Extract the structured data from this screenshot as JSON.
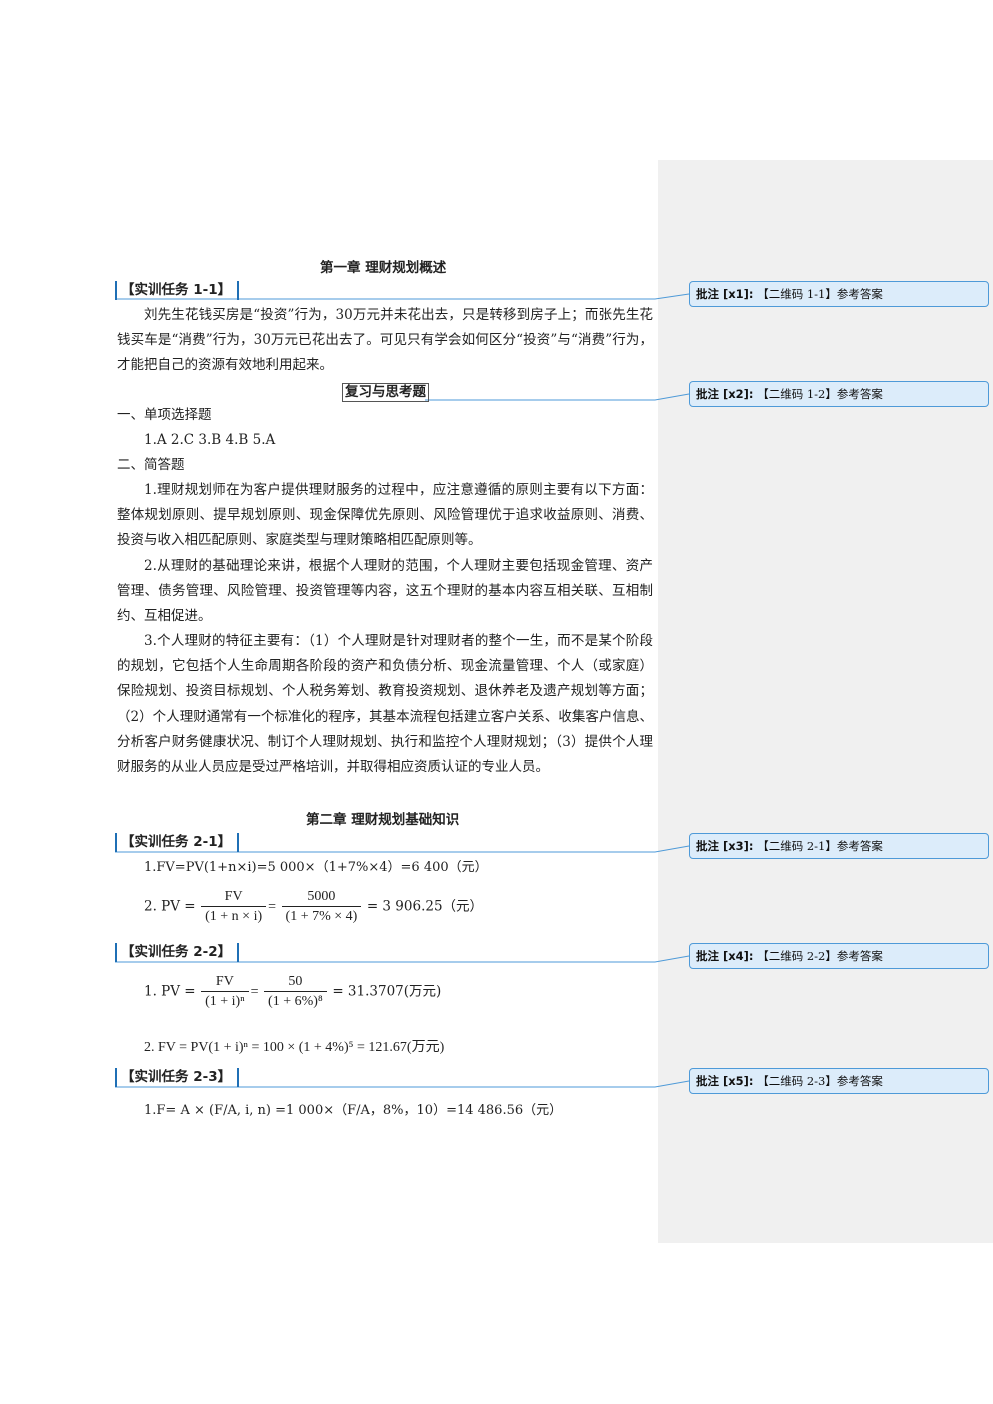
{
  "ch1": {
    "title": "第一章  理财规划概述",
    "task_1_1": "【实训任务 1-1】",
    "task_1_1_text": "刘先生花钱买房是“投资”行为，30万元并未花出去，只是转移到房子上；而张先生花钱买车是“消费”行为，30万元已花出去了。可见只有学会如何区分“投资”与“消费”行为，才能把自己的资源有效地利用起来。",
    "review_title": "复习与思考题",
    "single_choice_heading": "一、单项选择题",
    "single_choice_answers": "1.A   2.C   3.B   4.B   5.A",
    "short_answer_heading": "二、简答题",
    "answer_1": "1.理财规划师在为客户提供理财服务的过程中，应注意遵循的原则主要有以下方面：整体规划原则、提早规划原则、现金保障优先原则、风险管理优于追求收益原则、消费、投资与收入相匹配原则、家庭类型与理财策略相匹配原则等。",
    "answer_2": "2.从理财的基础理论来讲，根据个人理财的范围，个人理财主要包括现金管理、资产管理、债务管理、风险管理、投资管理等内容，这五个理财的基本内容互相关联、互相制约、互相促进。",
    "answer_3": "3.个人理财的特征主要有：（1）个人理财是针对理财者的整个一生，而不是某个阶段的规划，它包括个人生命周期各阶段的资产和负债分析、现金流量管理、个人（或家庭）保险规划、投资目标规划、个人税务筹划、教育投资规划、退休养老及遗产规划等方面；（2）个人理财通常有一个标准化的程序，其基本流程包括建立客户关系、收集客户信息、分析客户财务健康状况、制订个人理财规划、执行和监控个人理财规划；（3）提供个人理财服务的从业人员应是受过严格培训，并取得相应资质认证的专业人员。"
  },
  "ch2": {
    "title": "第二章  理财规划基础知识",
    "task_2_1": "【实训任务 2-1】",
    "f_2_1_1": "1.FV=PV(1+n×i)=5 000×（1+7%×4）=6 400（元）",
    "f_2_1_2_label": "2. PV =",
    "f_2_1_2_num1": "FV",
    "f_2_1_2_den1": "(1 + n × i)",
    "f_2_1_2_num2": "5000",
    "f_2_1_2_den2": "(1 + 7% × 4)",
    "f_2_1_2_result": "= 3  906.25（元）",
    "task_2_2": "【实训任务 2-2】",
    "f_2_2_1_label": "1. PV =",
    "f_2_2_1_num1": "FV",
    "f_2_2_1_den1": "(1 + i)ⁿ",
    "f_2_2_1_num2": "50",
    "f_2_2_1_den2": "(1 + 6%)⁸",
    "f_2_2_1_result": "= 31.3707(万元)",
    "f_2_2_2": "2. FV = PV(1 + i)ⁿ = 100 × (1 + 4%)⁵ = 121.67(万元)",
    "task_2_3": "【实训任务 2-3】",
    "f_2_3_1": "1.F= A × (F/A, i, n) =1 000×（F/A，8%，10）=14  486.56（元）"
  },
  "comments": [
    {
      "tag": "批注 [x1]:",
      "text": "【二维码 1-1】参考答案"
    },
    {
      "tag": "批注 [x2]:",
      "text": "【二维码 1-2】参考答案"
    },
    {
      "tag": "批注 [x3]:",
      "text": "【二维码 2-1】参考答案"
    },
    {
      "tag": "批注 [x4]:",
      "text": "【二维码 2-2】参考答案"
    },
    {
      "tag": "批注 [x5]:",
      "text": "【二维码 2-3】参考答案"
    }
  ],
  "colors": {
    "accent": "#1f6fb5",
    "comment_border": "#4e9ad8",
    "comment_bg": "#dcecfa",
    "margin_bg": "#f0f0f0"
  }
}
